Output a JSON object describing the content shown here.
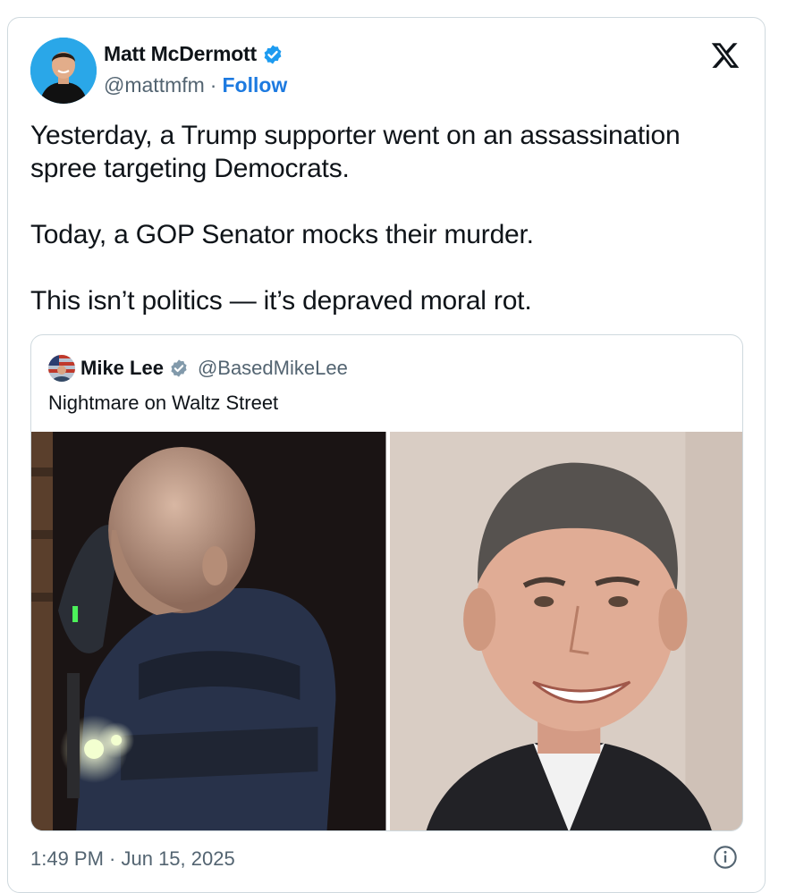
{
  "tweet": {
    "author": {
      "name": "Matt McDermott",
      "handle": "@mattmfm",
      "separator": "·",
      "follow_label": "Follow",
      "verified_color": "#1d9bf0"
    },
    "paragraphs": [
      "Yesterday, a Trump supporter went on an assassination spree targeting Democrats.",
      "Today, a GOP Senator mocks their murder.",
      "This isn’t politics — it’s depraved moral rot."
    ],
    "timestamp": "1:49 PM · Jun 15, 2025",
    "brand_icon": "x-logo-icon",
    "info_icon": "info-icon"
  },
  "quote": {
    "author": {
      "name": "Mike Lee",
      "handle": "@BasedMikeLee",
      "verified_color": "#829aab"
    },
    "text": "Nightmare on Waltz Street",
    "images": [
      "masked-man-in-tactical-vest-photo",
      "smiling-man-in-suit-portrait"
    ]
  },
  "colors": {
    "link": "#1d7ae0",
    "secondary_text": "#536471",
    "border": "#cfd9de"
  }
}
